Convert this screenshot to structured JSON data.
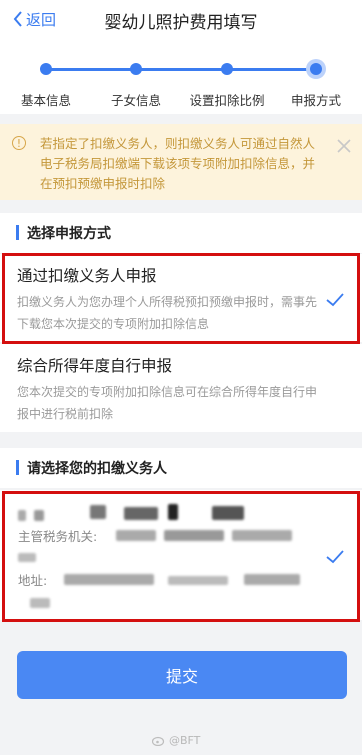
{
  "nav": {
    "back_label": "返回",
    "title": "婴幼儿照护费用填写"
  },
  "steps": [
    {
      "label": "基本信息"
    },
    {
      "label": "子女信息"
    },
    {
      "label": "设置扣除比例"
    },
    {
      "label": "申报方式"
    }
  ],
  "current_step": 4,
  "notice": {
    "text": "若指定了扣缴义务人，则扣缴义务人可通过自然人电子税务局扣缴端下载该项专项附加扣除信息，并在预扣预缴申报时扣除"
  },
  "section_method": {
    "title": "选择申报方式"
  },
  "options": [
    {
      "title": "通过扣缴义务人申报",
      "desc": "扣缴义务人为您办理个人所得税预扣预缴申报时，需事先下载您本次提交的专项附加扣除信息",
      "selected": true
    },
    {
      "title": "综合所得年度自行申报",
      "desc": "您本次提交的专项附加扣除信息可在综合所得年度自行申报中进行税前扣除",
      "selected": false
    }
  ],
  "section_agent": {
    "title": "请选择您的扣缴义务人"
  },
  "agent": {
    "tax_authority_label": "主管税务机关:",
    "address_label": "地址:",
    "selected": true
  },
  "submit_label": "提交",
  "watermark": "@BFT",
  "colors": {
    "accent": "#3b7cf0",
    "highlight_box": "#d40f0f",
    "notice_bg": "#fdf3dc",
    "notice_text": "#c4973a"
  }
}
